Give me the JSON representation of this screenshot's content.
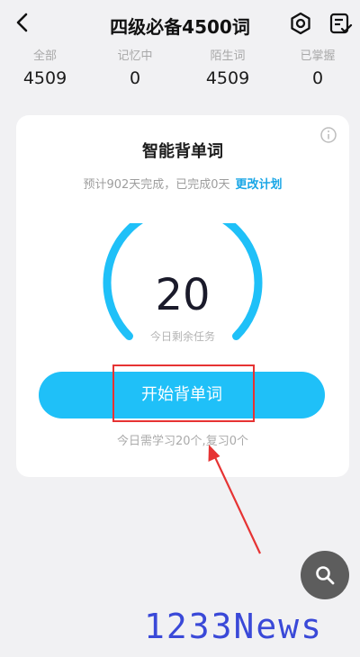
{
  "header": {
    "title": "四级必备4500词",
    "icons": {
      "back": "chevron-left-icon",
      "settings": "gear-icon",
      "list": "list-edit-icon"
    }
  },
  "stats": [
    {
      "label": "全部",
      "value": "4509"
    },
    {
      "label": "记忆中",
      "value": "0"
    },
    {
      "label": "陌生词",
      "value": "4509"
    },
    {
      "label": "已掌握",
      "value": "0"
    }
  ],
  "card": {
    "title": "智能背单词",
    "plan_text": "预计902天完成，已完成0天",
    "plan_link": "更改计划",
    "remaining_count": "20",
    "remaining_label": "今日剩余任务",
    "start_button": "开始背单词",
    "today_text": "今日需学习20个,复习0个",
    "gauge_color": "#1fc0f8"
  },
  "watermark": "1233News",
  "colors": {
    "accent": "#1fc0f8",
    "link": "#19a6e6",
    "annotation": "#e63333",
    "fab": "#5d5d5d"
  }
}
